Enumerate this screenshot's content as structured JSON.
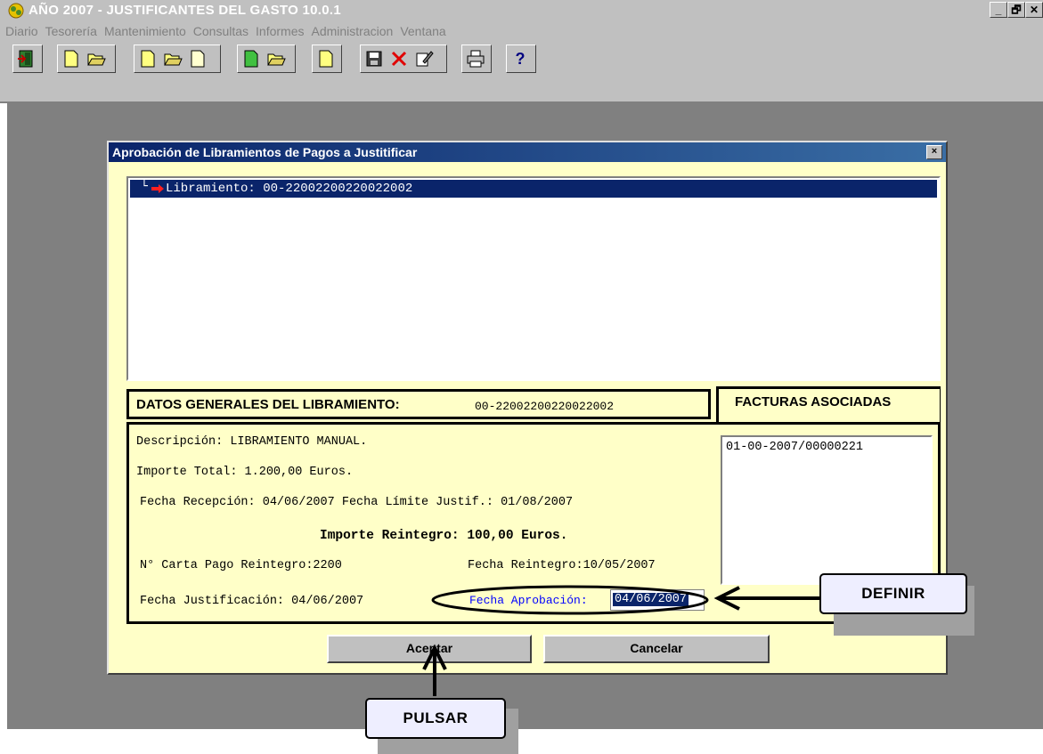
{
  "window": {
    "title": "AÑO 2007 - JUSTIFICANTES DEL GASTO 10.0.1",
    "controls": [
      "_",
      "🗗",
      "✕"
    ]
  },
  "menu": [
    "Diario",
    "Tesorería",
    "Mantenimiento",
    "Consultas",
    "Informes",
    "Administracion",
    "Ventana"
  ],
  "toolbar": {
    "icons": [
      "exit-icon",
      "new-icon",
      "open-icon",
      "new-icon",
      "open-icon",
      "new-icon",
      "new-green-icon",
      "open-icon",
      "new-icon",
      "save-icon",
      "delete-icon",
      "edit-icon",
      "print-icon",
      "help-icon"
    ],
    "help_label": "?"
  },
  "dialog": {
    "title": "Aprobación de Libramientos de Pagos a Justitificar",
    "close": "×",
    "tree_item": "Libramiento: 00-22002200220022002",
    "general_label": "DATOS GENERALES DEL LIBRAMIENTO:",
    "general_value": "00-22002200220022002",
    "facturas_label": "FACTURAS ASOCIADAS",
    "facturas": [
      "01-00-2007/00000221"
    ],
    "descripcion": "Descripción: LIBRAMIENTO MANUAL.",
    "importe_total": "Importe Total:  1.200,00 Euros.",
    "fechas_line": "Fecha Recepción: 04/06/2007  Fecha Límite Justif.:  01/08/2007",
    "importe_reintegro": "Importe Reintegro: 100,00 Euros.",
    "carta_pago": "N° Carta Pago Reintegro:2200",
    "fecha_reintegro": "Fecha Reintegro:10/05/2007",
    "fecha_justificacion": "Fecha Justificación: 04/06/2007",
    "fecha_aprobacion_label": "Fecha Aprobación:",
    "fecha_aprobacion_value": "04/06/2007",
    "accept": "Aceptar",
    "cancel": "Cancelar"
  },
  "callouts": {
    "definir": "DEFINIR",
    "pulsar": "PULSAR"
  },
  "colors": {
    "dialog_bg": "#ffffc8",
    "selection": "#0a246a",
    "workspace": "#808080",
    "callout_bg": "#eeeeff"
  }
}
